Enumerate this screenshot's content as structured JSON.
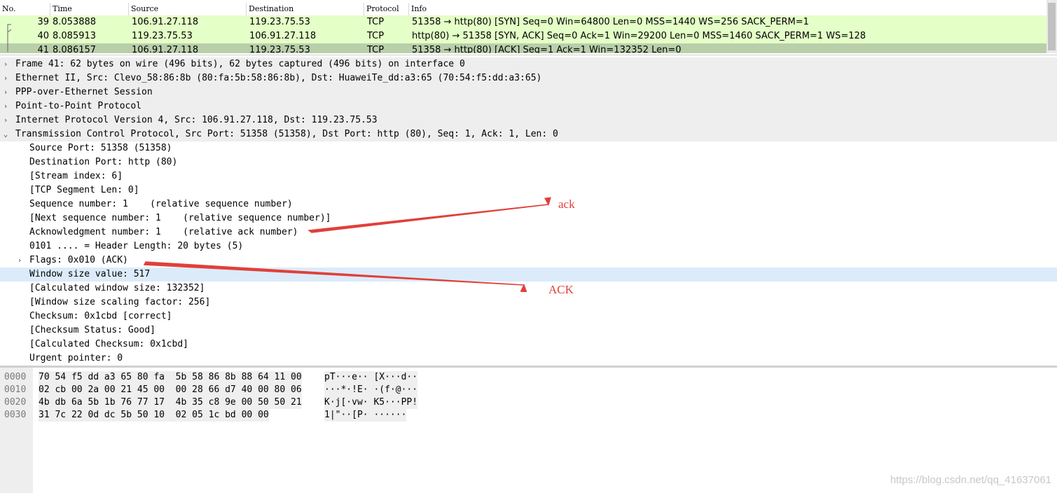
{
  "packet_list": {
    "columns": [
      "No.",
      "Time",
      "Source",
      "Destination",
      "Protocol",
      "Info"
    ],
    "rows": [
      {
        "no": "39",
        "time": "8.053888",
        "source": "106.91.27.118",
        "destination": "119.23.75.53",
        "protocol": "TCP",
        "info": "51358 → http(80) [SYN] Seq=0 Win=64800 Len=0 MSS=1440 WS=256 SACK_PERM=1"
      },
      {
        "no": "40",
        "time": "8.085913",
        "source": "119.23.75.53",
        "destination": "106.91.27.118",
        "protocol": "TCP",
        "info": "http(80) → 51358 [SYN, ACK] Seq=0 Ack=1 Win=29200 Len=0 MSS=1460 SACK_PERM=1 WS=128"
      },
      {
        "no": "41",
        "time": "8.086157",
        "source": "106.91.27.118",
        "destination": "119.23.75.53",
        "protocol": "TCP",
        "info": "51358 → http(80) [ACK] Seq=1 Ack=1 Win=132352 Len=0"
      }
    ],
    "colors": {
      "row_bg": "#e4ffc7",
      "selected_bg": "#b9cfaa"
    }
  },
  "details": {
    "top_items": [
      {
        "label": "Frame 41: 62 bytes on wire (496 bits), 62 bytes captured (496 bits) on interface 0",
        "expanded": false
      },
      {
        "label": "Ethernet II, Src: Clevo_58:86:8b (80:fa:5b:58:86:8b), Dst: HuaweiTe_dd:a3:65 (70:54:f5:dd:a3:65)",
        "expanded": false
      },
      {
        "label": "PPP-over-Ethernet Session",
        "expanded": false
      },
      {
        "label": "Point-to-Point Protocol",
        "expanded": false
      },
      {
        "label": "Internet Protocol Version 4, Src: 106.91.27.118, Dst: 119.23.75.53",
        "expanded": false
      },
      {
        "label": "Transmission Control Protocol, Src Port: 51358 (51358), Dst Port: http (80), Seq: 1, Ack: 1, Len: 0",
        "expanded": true
      }
    ],
    "tcp_fields": [
      "Source Port: 51358 (51358)",
      "Destination Port: http (80)",
      "[Stream index: 6]",
      "[TCP Segment Len: 0]",
      "Sequence number: 1    (relative sequence number)",
      "[Next sequence number: 1    (relative sequence number)]",
      "Acknowledgment number: 1    (relative ack number)",
      "0101 .... = Header Length: 20 bytes (5)",
      "Flags: 0x010 (ACK)",
      "Window size value: 517",
      "[Calculated window size: 132352]",
      "[Window size scaling factor: 256]",
      "Checksum: 0x1cbd [correct]",
      "[Checksum Status: Good]",
      "[Calculated Checksum: 0x1cbd]",
      "Urgent pointer: 0"
    ],
    "highlighted_field_index": 9,
    "colors": {
      "highlight_bg": "#dcebfa"
    }
  },
  "bytes": {
    "rows": [
      {
        "offset": "0000",
        "hex": "70 54 f5 dd a3 65 80 fa  5b 58 86 8b 88 64 11 00",
        "ascii": "pT···e·· [X···d··"
      },
      {
        "offset": "0010",
        "hex": "02 cb 00 2a 00 21 45 00  00 28 66 d7 40 00 80 06",
        "ascii": "···*·!E· ·(f·@···"
      },
      {
        "offset": "0020",
        "hex": "4b db 6a 5b 1b 76 77 17  4b 35 c8 9e 00 50 50 21",
        "ascii": "K·j[·vw· K5···PP!"
      },
      {
        "offset": "0030",
        "hex": "31 7c 22 0d dc 5b 50 10  02 05 1c bd 00 00",
        "ascii": "1|\"··[P· ······"
      }
    ]
  },
  "annotations": {
    "ack_lower": "ack",
    "ack_upper": "ACK",
    "color": "#e0403a"
  },
  "watermark": "https://blog.csdn.net/qq_41637061"
}
